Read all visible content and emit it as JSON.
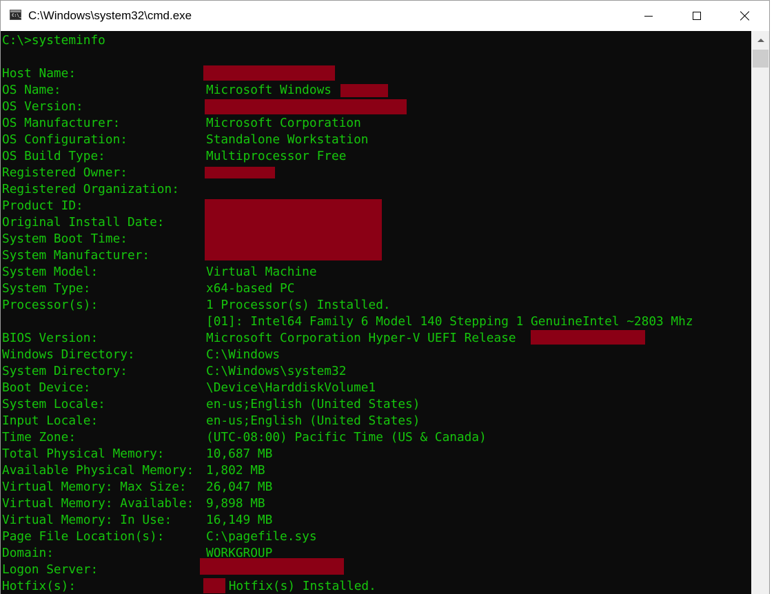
{
  "window": {
    "title": "C:\\Windows\\system32\\cmd.exe",
    "icon_text": "C:\\_"
  },
  "console": {
    "prompt_line": "C:\\>systeminfo",
    "labels": {
      "host_name": "Host Name:",
      "os_name": "OS Name:",
      "os_version": "OS Version:",
      "os_manufacturer": "OS Manufacturer:",
      "os_configuration": "OS Configuration:",
      "os_build_type": "OS Build Type:",
      "registered_owner": "Registered Owner:",
      "registered_organization": "Registered Organization:",
      "product_id": "Product ID:",
      "original_install_date": "Original Install Date:",
      "system_boot_time": "System Boot Time:",
      "system_manufacturer": "System Manufacturer:",
      "system_model": "System Model:",
      "system_type": "System Type:",
      "processors": "Processor(s):",
      "bios_version": "BIOS Version:",
      "windows_directory": "Windows Directory:",
      "system_directory": "System Directory:",
      "boot_device": "Boot Device:",
      "system_locale": "System Locale:",
      "input_locale": "Input Locale:",
      "time_zone": "Time Zone:",
      "total_physical_memory": "Total Physical Memory:",
      "available_physical_memory": "Available Physical Memory:",
      "virtual_memory_max": "Virtual Memory: Max Size:",
      "virtual_memory_available": "Virtual Memory: Available:",
      "virtual_memory_in_use": "Virtual Memory: In Use:",
      "page_file_locations": "Page File Location(s):",
      "domain": "Domain:",
      "logon_server": "Logon Server:",
      "hotfixes": "Hotfix(s):"
    },
    "values": {
      "os_name": "Microsoft Windows",
      "os_manufacturer": "Microsoft Corporation",
      "os_configuration": "Standalone Workstation",
      "os_build_type": "Multiprocessor Free",
      "system_model": "Virtual Machine",
      "system_type": "x64-based PC",
      "processors": "1 Processor(s) Installed.",
      "processor_detail": "[01]: Intel64 Family 6 Model 140 Stepping 1 GenuineIntel ~2803 Mhz",
      "bios_version": "Microsoft Corporation Hyper-V UEFI Release",
      "windows_directory": "C:\\Windows",
      "system_directory": "C:\\Windows\\system32",
      "boot_device": "\\Device\\HarddiskVolume1",
      "system_locale": "en-us;English (United States)",
      "input_locale": "en-us;English (United States)",
      "time_zone": "(UTC-08:00) Pacific Time (US & Canada)",
      "total_physical_memory": "10,687 MB",
      "available_physical_memory": "1,802 MB",
      "virtual_memory_max": "26,047 MB",
      "virtual_memory_available": "9,898 MB",
      "virtual_memory_in_use": "16,149 MB",
      "page_file_locations": "C:\\pagefile.sys",
      "domain": "WORKGROUP",
      "hotfixes": " Hotfix(s) Installed."
    }
  },
  "colors": {
    "console_bg": "#0c0c0c",
    "console_text": "#16c60c",
    "redaction": "#8b0015",
    "titlebar_bg": "#ffffff",
    "scrollbar_bg": "#f0f0f0"
  }
}
